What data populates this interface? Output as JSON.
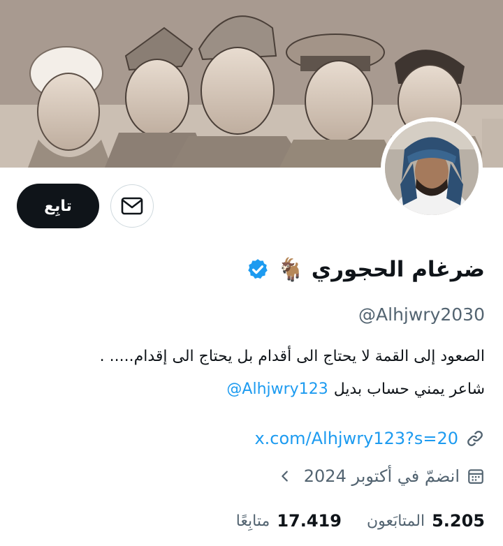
{
  "header": {
    "banner_image": "sketch-portraits-of-five-men",
    "avatar_image": "man-with-blue-headscarf"
  },
  "actions": {
    "follow_label": "تابِع",
    "message_icon": "mail-icon"
  },
  "profile": {
    "display_name": "ضرغام الحجوري",
    "name_emoji": "🐐",
    "verified_icon": "verified-badge-icon",
    "verified_color": "#1d9bf0",
    "handle": "@Alhjwry2030"
  },
  "bio": {
    "line1": "الصعود إلى القمة لا يحتاج الى أقدام بل يحتاج الى إقدام..... .",
    "line2_text": "شاعر يمني حساب بديل",
    "line2_mention": "@Alhjwry123"
  },
  "meta": {
    "link_icon": "link-icon",
    "link": "x.com/Alhjwry123?s=20",
    "joined_icon": "calendar-icon",
    "joined": "انضمّ في أكتوبر 2024",
    "chevron_icon": "chevron-left-icon"
  },
  "stats": {
    "followers_count": "5.205",
    "followers_label": "المتابَعون",
    "following_count": "17.419",
    "following_label": "متابِعًا"
  },
  "colors": {
    "accent": "#1d9bf0",
    "primary_text": "#0f1419",
    "secondary_text": "#536471",
    "border": "#cfd9de"
  }
}
